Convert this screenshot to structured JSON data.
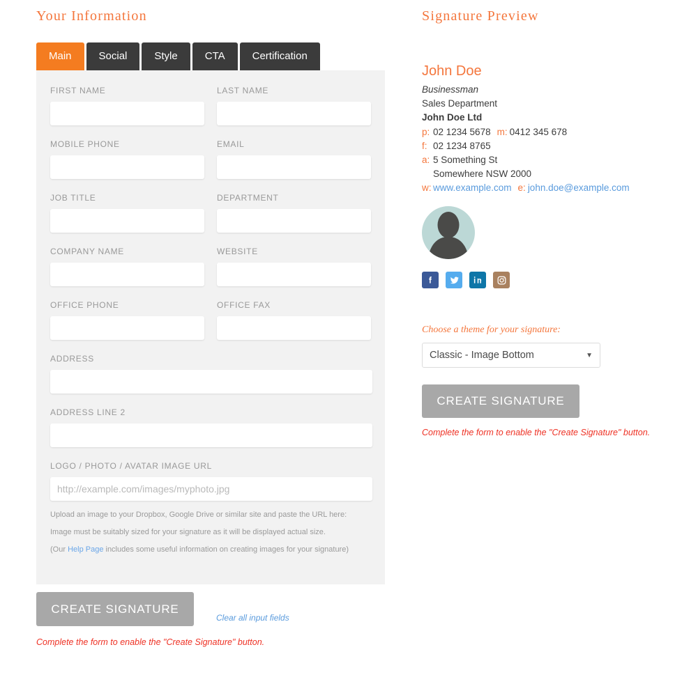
{
  "left": {
    "section_title": "Your Information",
    "tabs": [
      {
        "label": "Main",
        "active": true
      },
      {
        "label": "Social",
        "active": false
      },
      {
        "label": "Style",
        "active": false
      },
      {
        "label": "CTA",
        "active": false
      },
      {
        "label": "Certification",
        "active": false
      }
    ],
    "fields": {
      "first_name": {
        "label": "FIRST NAME",
        "value": "",
        "placeholder": ""
      },
      "last_name": {
        "label": "LAST NAME",
        "value": "",
        "placeholder": ""
      },
      "mobile_phone": {
        "label": "MOBILE PHONE",
        "value": "",
        "placeholder": ""
      },
      "email": {
        "label": "EMAIL",
        "value": "",
        "placeholder": ""
      },
      "job_title": {
        "label": "JOB TITLE",
        "value": "",
        "placeholder": ""
      },
      "department": {
        "label": "DEPARTMENT",
        "value": "",
        "placeholder": ""
      },
      "company_name": {
        "label": "COMPANY NAME",
        "value": "",
        "placeholder": ""
      },
      "website": {
        "label": "WEBSITE",
        "value": "",
        "placeholder": ""
      },
      "office_phone": {
        "label": "OFFICE PHONE",
        "value": "",
        "placeholder": ""
      },
      "office_fax": {
        "label": "OFFICE FAX",
        "value": "",
        "placeholder": ""
      },
      "address": {
        "label": "ADDRESS",
        "value": "",
        "placeholder": ""
      },
      "address_line_2": {
        "label": "ADDRESS LINE 2",
        "value": "",
        "placeholder": ""
      },
      "image_url": {
        "label": "LOGO / PHOTO / AVATAR IMAGE URL",
        "value": "",
        "placeholder": "http://example.com/images/myphoto.jpg"
      }
    },
    "help": {
      "line1": "Upload an image to your Dropbox, Google Drive or similar site and paste the URL here:",
      "line2": "Image must be suitably sized for your signature as it will be displayed actual size.",
      "line3_pre": "(Our ",
      "line3_link": "Help Page",
      "line3_post": " includes some useful information on creating images for your signature)"
    },
    "actions": {
      "create_button": "CREATE SIGNATURE",
      "clear_link": "Clear all input fields",
      "warning": "Complete the form to enable the \"Create Signature\" button."
    }
  },
  "right": {
    "section_title": "Signature Preview",
    "signature": {
      "name": "John Doe",
      "job_title": "Businessman",
      "department": "Sales Department",
      "company": "John Doe Ltd",
      "phone_prefix": "p:",
      "phone": "02 1234 5678",
      "mobile_prefix": "m:",
      "mobile": "0412 345 678",
      "fax_prefix": "f:",
      "fax": "02 1234 8765",
      "address_prefix": "a:",
      "address_line1": "5 Something St",
      "address_line2": "Somewhere NSW 2000",
      "web_prefix": "w:",
      "website": "www.example.com",
      "email_prefix": "e:",
      "email": "john.doe@example.com"
    },
    "social": [
      {
        "name": "facebook",
        "color": "#3b5998"
      },
      {
        "name": "twitter",
        "color": "#55acee"
      },
      {
        "name": "linkedin",
        "color": "#0e76a8"
      },
      {
        "name": "instagram",
        "color": "#a9815f"
      }
    ],
    "theme": {
      "label": "Choose a theme for your signature:",
      "selected": "Classic - Image Bottom",
      "caret": "▼"
    },
    "actions": {
      "create_button": "CREATE SIGNATURE",
      "warning": "Complete the form to enable the \"Create Signature\" button."
    }
  },
  "colors": {
    "accent": "#f4763c",
    "tab_active": "#f47c20",
    "tab_inactive": "#3b3b3b",
    "warning": "#ee3124",
    "link": "#5a9bdd",
    "button_disabled": "#a8a8a8",
    "panel_bg": "#f2f2f2"
  }
}
